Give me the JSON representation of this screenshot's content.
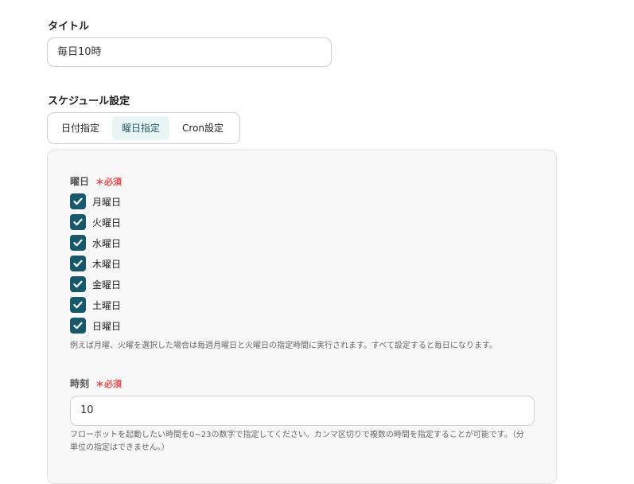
{
  "title_field": {
    "label": "タイトル",
    "value": "毎日10時"
  },
  "schedule": {
    "label": "スケジュール設定",
    "tabs": [
      {
        "label": "日付指定",
        "active": false
      },
      {
        "label": "曜日指定",
        "active": true
      },
      {
        "label": "Cron設定",
        "active": false
      }
    ]
  },
  "weekday": {
    "label": "曜日",
    "required_label": "＊必須",
    "days": [
      {
        "label": "月曜日",
        "checked": true
      },
      {
        "label": "火曜日",
        "checked": true
      },
      {
        "label": "水曜日",
        "checked": true
      },
      {
        "label": "木曜日",
        "checked": true
      },
      {
        "label": "金曜日",
        "checked": true
      },
      {
        "label": "土曜日",
        "checked": true
      },
      {
        "label": "日曜日",
        "checked": true
      }
    ],
    "hint": "例えば月曜、火曜を選択した場合は毎週月曜日と火曜日の指定時間に実行されます。すべて設定すると毎日になります。"
  },
  "time": {
    "label": "時刻",
    "required_label": "＊必須",
    "value": "10",
    "hint_line1": "フローボットを起動したい時間を0~23の数字で指定してください。カンマ区切りで複数の時間を指定することが可能です。（分",
    "hint_line2": "単位の指定はできません。）"
  },
  "colors": {
    "checkbox": "#17596a",
    "required": "#e34a4a",
    "active_tab_bg": "#e9f4f4"
  }
}
